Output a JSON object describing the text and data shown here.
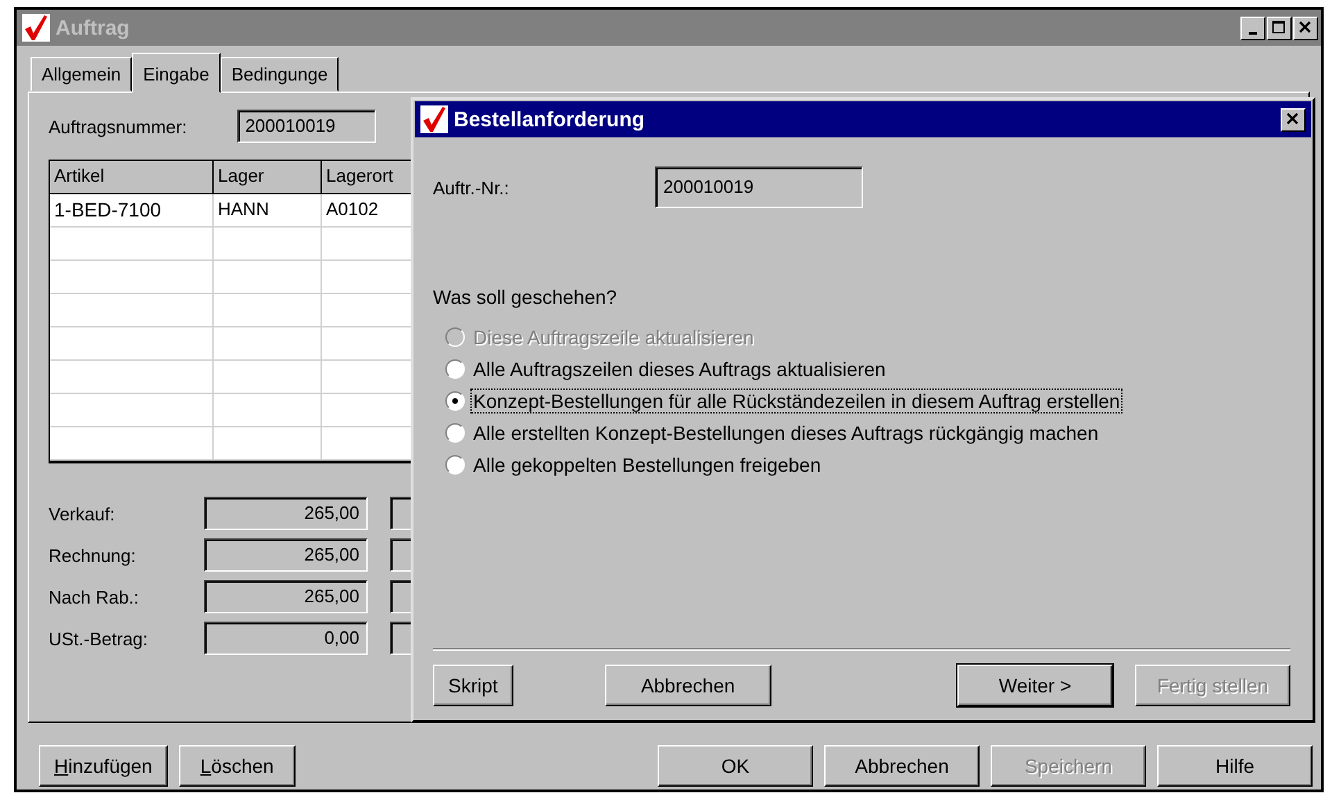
{
  "window": {
    "title": "Auftrag"
  },
  "tabs": [
    {
      "label": "Allgemein",
      "selected": false
    },
    {
      "label": "Eingabe",
      "selected": true
    },
    {
      "label": "Bedingunge",
      "selected": false
    }
  ],
  "order_number": {
    "label": "Auftragsnummer:",
    "value": "200010019"
  },
  "table": {
    "columns": [
      "Artikel",
      "Lager",
      "Lagerort"
    ],
    "rows": [
      {
        "cells": [
          "1-BED-7100",
          "HANN",
          "A0102"
        ]
      }
    ]
  },
  "totals": [
    {
      "label": "Verkauf:",
      "value": "265,00"
    },
    {
      "label": "Rechnung:",
      "value": "265,00"
    },
    {
      "label": "Nach Rab.:",
      "value": "265,00"
    },
    {
      "label": "USt.-Betrag:",
      "value": "0,00"
    }
  ],
  "buttons_left": [
    {
      "accel": "H",
      "rest": "inzufügen"
    },
    {
      "accel": "L",
      "rest": "öschen"
    }
  ],
  "buttons_right": [
    {
      "label": "OK",
      "disabled": false
    },
    {
      "label": "Abbrechen",
      "disabled": false
    },
    {
      "label": "Speichern",
      "disabled": true
    },
    {
      "label": "Hilfe",
      "disabled": false
    }
  ],
  "dialog": {
    "title": "Bestellanforderung",
    "number": {
      "label": "Auftr.-Nr.:",
      "value": "200010019"
    },
    "question": "Was soll geschehen?",
    "options": [
      {
        "label": "Diese Auftragszeile aktualisieren",
        "selected": false,
        "disabled": true
      },
      {
        "label": "Alle Auftragszeilen dieses Auftrags aktualisieren",
        "selected": false,
        "disabled": false
      },
      {
        "label": "Konzept-Bestellungen für alle Rückständezeilen in diesem Auftrag erstellen",
        "selected": true,
        "disabled": false
      },
      {
        "label": "Alle erstellten Konzept-Bestellungen dieses Auftrags rückgängig machen",
        "selected": false,
        "disabled": false
      },
      {
        "label": "Alle gekoppelten Bestellungen freigeben",
        "selected": false,
        "disabled": false
      }
    ],
    "buttons_left": [
      {
        "label": "Skript"
      },
      {
        "label": "Abbrechen"
      }
    ],
    "buttons_right": [
      {
        "label": "Weiter >",
        "disabled": false,
        "default": true
      },
      {
        "label": "Fertig stellen",
        "disabled": true,
        "default": false
      }
    ]
  }
}
